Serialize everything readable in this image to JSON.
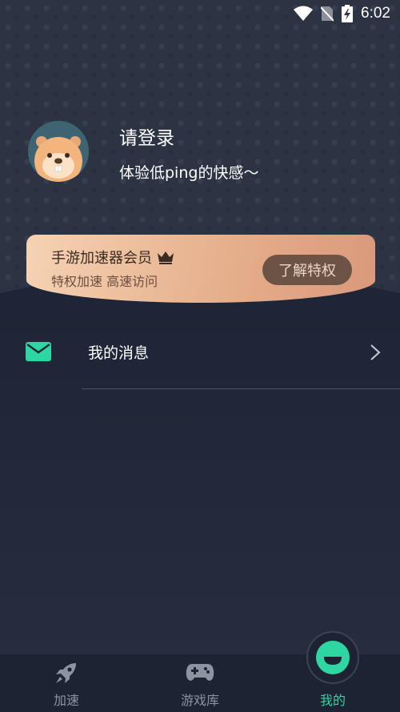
{
  "status_bar": {
    "time": "6:02",
    "icons": [
      "wifi-icon",
      "no-sim-icon",
      "battery-charging-icon"
    ]
  },
  "profile": {
    "title": "请登录",
    "subtitle": "体验低ping的快感～",
    "avatar": "beaver-avatar"
  },
  "vip": {
    "title": "手游加速器会员",
    "subtitle": "特权加速 高速访问",
    "button": "了解特权",
    "icon": "crown-icon"
  },
  "menu": {
    "messages_label": "我的消息",
    "messages_icon": "mail-icon"
  },
  "nav": {
    "items": [
      {
        "label": "加速",
        "icon": "rocket-icon"
      },
      {
        "label": "游戏库",
        "icon": "gamepad-icon"
      },
      {
        "label": "我的",
        "icon": "face-icon"
      }
    ],
    "active_index": 2
  },
  "colors": {
    "accent": "#2ed6a2",
    "background": "#232a3a",
    "vip_gold": "#e6b08d"
  }
}
